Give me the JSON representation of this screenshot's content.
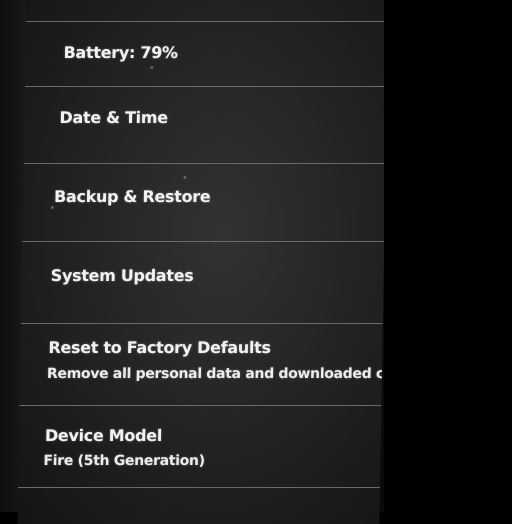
{
  "settings": {
    "items": [
      {
        "title": "Battery: 79%"
      },
      {
        "title": "Date & Time"
      },
      {
        "title": "Backup & Restore"
      },
      {
        "title": "System Updates"
      },
      {
        "title": "Reset to Factory Defaults",
        "subtitle": "Remove all personal data and downloaded conten"
      },
      {
        "title": "Device Model",
        "subtitle": "Fire (5th Generation)"
      }
    ]
  }
}
